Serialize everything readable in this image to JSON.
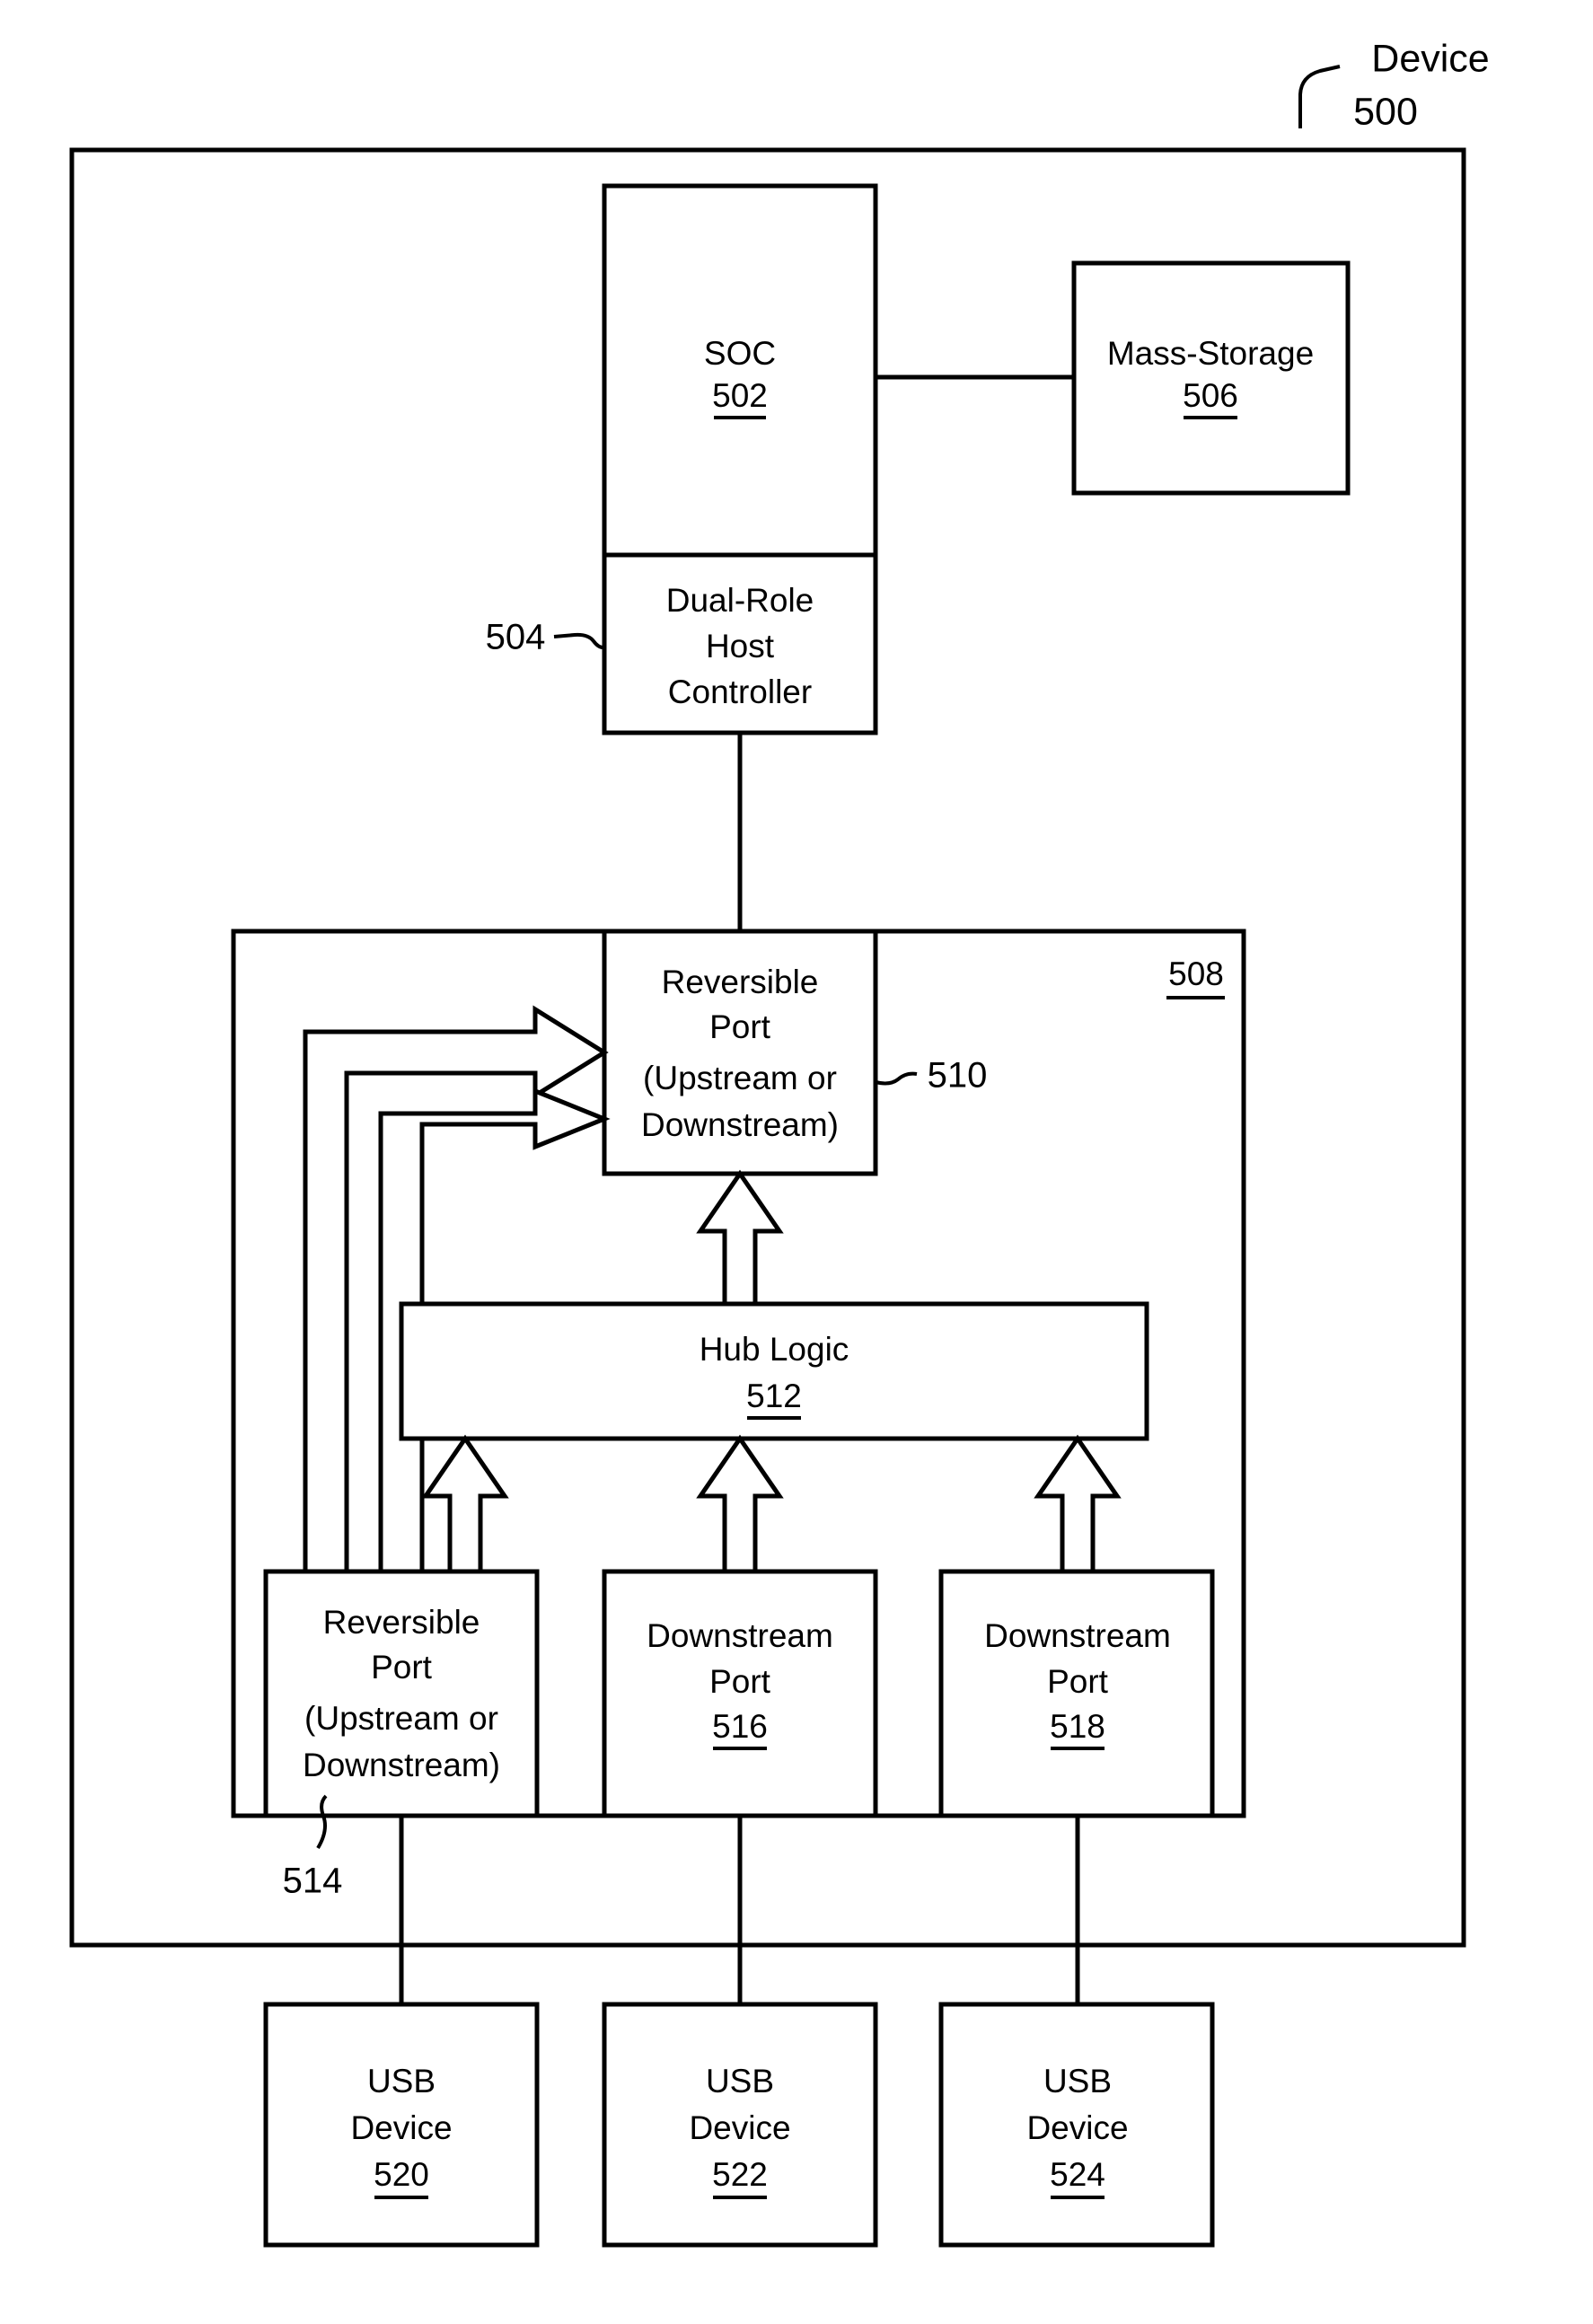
{
  "figure": {
    "title": "Device",
    "title_ref": "500"
  },
  "blocks": {
    "soc": {
      "label": "SOC",
      "ref": "502"
    },
    "host_controller": {
      "line1": "Dual-Role",
      "line2": "Host",
      "line3": "Controller",
      "ref": "504"
    },
    "mass_storage": {
      "label": "Mass-Storage",
      "ref": "506"
    },
    "hub": {
      "ref": "508"
    },
    "reversible_port_top": {
      "line1": "Reversible",
      "line2": "Port",
      "line3": "(Upstream or",
      "line4": "Downstream)",
      "ref": "510"
    },
    "hub_logic": {
      "label": "Hub Logic",
      "ref": "512"
    },
    "reversible_port_bottom": {
      "line1": "Reversible",
      "line2": "Port",
      "line3": "(Upstream or",
      "line4": "Downstream)",
      "ref": "514"
    },
    "downstream_port_1": {
      "line1": "Downstream",
      "line2": "Port",
      "ref": "516"
    },
    "downstream_port_2": {
      "line1": "Downstream",
      "line2": "Port",
      "ref": "518"
    },
    "usb_device_1": {
      "line1": "USB",
      "line2": "Device",
      "ref": "520"
    },
    "usb_device_2": {
      "line1": "USB",
      "line2": "Device",
      "ref": "522"
    },
    "usb_device_3": {
      "line1": "USB",
      "line2": "Device",
      "ref": "524"
    }
  },
  "colors": {
    "stroke": "#000000",
    "fill": "#ffffff"
  }
}
